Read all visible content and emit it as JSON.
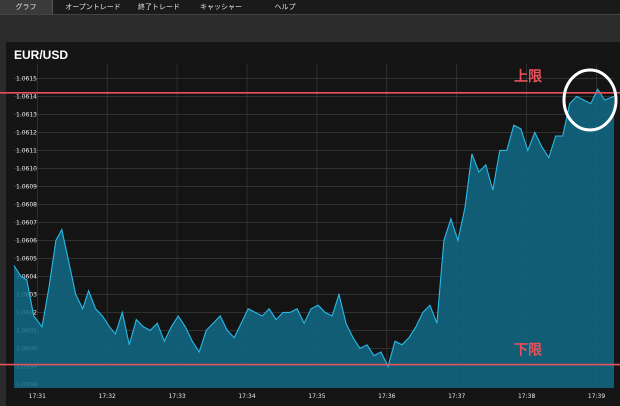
{
  "tabs": [
    {
      "label": "グラフ",
      "active": true
    },
    {
      "label": "オープントレード",
      "active": false
    },
    {
      "label": "終了トレード",
      "active": false
    },
    {
      "label": "キャッシャー",
      "active": false
    },
    {
      "label": "ヘルプ",
      "active": false
    }
  ],
  "chart_title": "EUR/USD",
  "annotations": {
    "upper_label": "上限",
    "lower_label": "下限",
    "color": "#e8505b"
  },
  "colors": {
    "line": "#29b9e6",
    "fill": "#0f6a86",
    "grid": "#3a3a3a",
    "tab_bar": "#1a1a1a"
  },
  "chart_data": {
    "type": "area",
    "title": "EUR/USD",
    "xlabel": "",
    "ylabel": "",
    "ylim": [
      1.05978,
      1.06158
    ],
    "xlim": [
      "17:30:40",
      "17:39:15"
    ],
    "yticks": [
      "1.0598",
      "1.0599",
      "1.0600",
      "1.0601",
      "1.0602",
      "1.0603",
      "1.0604",
      "1.0605",
      "1.0606",
      "1.0607",
      "1.0608",
      "1.0609",
      "1.0610",
      "1.0611",
      "1.0612",
      "1.0613",
      "1.0614",
      "1.0615"
    ],
    "xticks": [
      "17:31",
      "17:32",
      "17:33",
      "17:34",
      "17:35",
      "17:36",
      "17:37",
      "17:38",
      "17:39"
    ],
    "grid": true,
    "upper_limit": 1.06142,
    "lower_limit": 1.05991,
    "x": [
      "17:30:40",
      "17:30:46",
      "17:30:51",
      "17:30:57",
      "17:31:04",
      "17:31:10",
      "17:31:16",
      "17:31:21",
      "17:31:27",
      "17:31:33",
      "17:31:39",
      "17:31:44",
      "17:31:50",
      "17:31:56",
      "17:32:02",
      "17:32:07",
      "17:32:13",
      "17:32:19",
      "17:32:25",
      "17:32:31",
      "17:32:37",
      "17:32:43",
      "17:32:49",
      "17:32:55",
      "17:33:01",
      "17:33:07",
      "17:33:13",
      "17:33:19",
      "17:33:25",
      "17:33:31",
      "17:33:37",
      "17:33:43",
      "17:33:49",
      "17:33:55",
      "17:34:01",
      "17:34:07",
      "17:34:13",
      "17:34:19",
      "17:34:25",
      "17:34:31",
      "17:34:37",
      "17:34:43",
      "17:34:49",
      "17:34:55",
      "17:35:01",
      "17:35:07",
      "17:35:13",
      "17:35:19",
      "17:35:25",
      "17:35:31",
      "17:35:37",
      "17:35:43",
      "17:35:49",
      "17:35:55",
      "17:36:01",
      "17:36:07",
      "17:36:13",
      "17:36:19",
      "17:36:25",
      "17:36:31",
      "17:36:37",
      "17:36:43",
      "17:36:49",
      "17:36:55",
      "17:37:01",
      "17:37:07",
      "17:37:13",
      "17:37:19",
      "17:37:25",
      "17:37:31",
      "17:37:37",
      "17:37:43",
      "17:37:49",
      "17:37:55",
      "17:38:01",
      "17:38:07",
      "17:38:13",
      "17:38:19",
      "17:38:25",
      "17:38:31",
      "17:38:37",
      "17:38:43",
      "17:38:49",
      "17:38:55",
      "17:39:01",
      "17:39:07",
      "17:39:15"
    ],
    "values": [
      1.06046,
      1.0604,
      1.06038,
      1.06018,
      1.06012,
      1.06034,
      1.0606,
      1.06066,
      1.06048,
      1.0603,
      1.06022,
      1.06032,
      1.06022,
      1.06018,
      1.06012,
      1.06008,
      1.0602,
      1.06002,
      1.06016,
      1.06012,
      1.0601,
      1.06014,
      1.06004,
      1.06012,
      1.06018,
      1.06012,
      1.06004,
      1.05998,
      1.0601,
      1.06014,
      1.06018,
      1.0601,
      1.06006,
      1.06014,
      1.06022,
      1.0602,
      1.06018,
      1.06022,
      1.06016,
      1.0602,
      1.0602,
      1.06022,
      1.06014,
      1.06022,
      1.06024,
      1.0602,
      1.06018,
      1.0603,
      1.06014,
      1.06006,
      1.06,
      1.06002,
      1.05996,
      1.05998,
      1.0599,
      1.06004,
      1.06002,
      1.06006,
      1.06012,
      1.0602,
      1.06024,
      1.06014,
      1.0606,
      1.06072,
      1.0606,
      1.06078,
      1.06108,
      1.06098,
      1.06102,
      1.06088,
      1.0611,
      1.0611,
      1.06124,
      1.06122,
      1.0611,
      1.0612,
      1.06112,
      1.06106,
      1.06118,
      1.06118,
      1.06136,
      1.0614,
      1.06138,
      1.06136,
      1.06144,
      1.06138,
      1.0614
    ]
  }
}
